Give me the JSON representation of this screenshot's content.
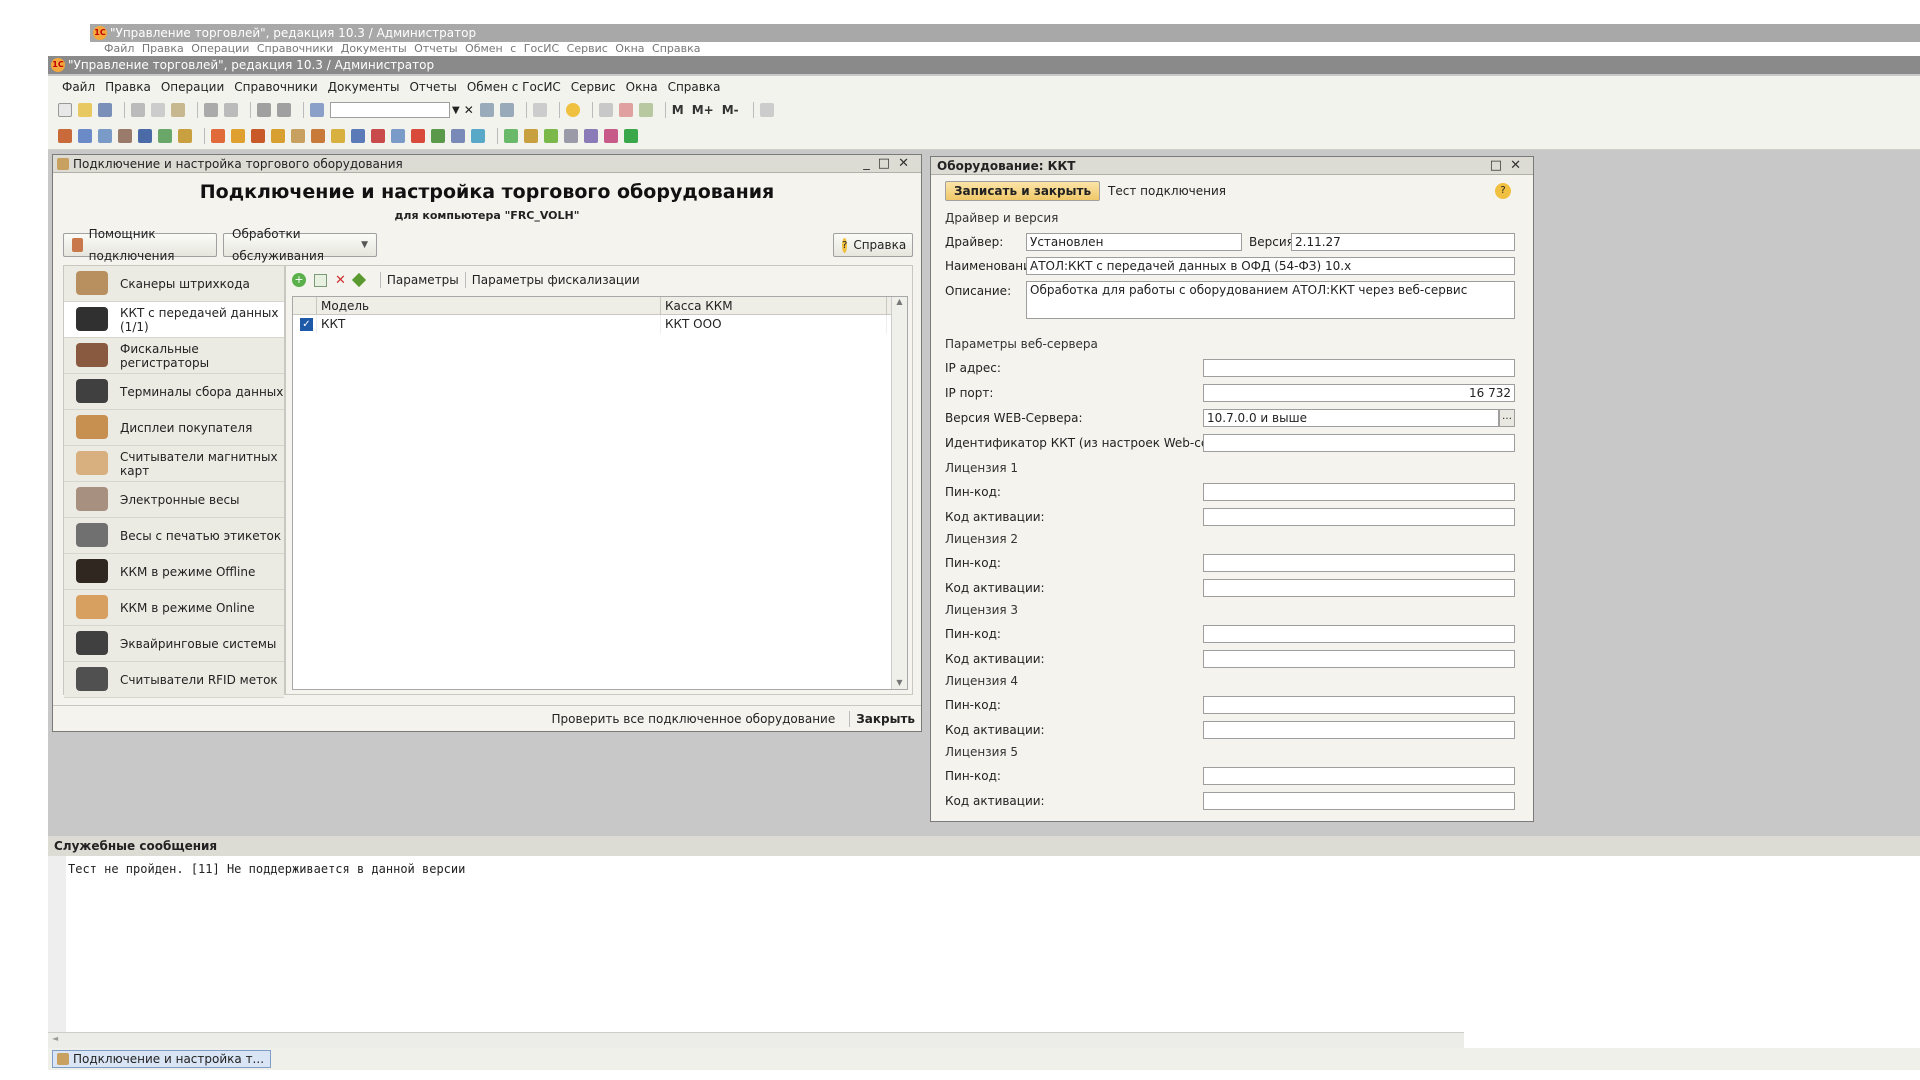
{
  "background_window": {
    "title": "\"Управление торговлей\", редакция 10.3 / Администратор",
    "menu": "Файл Правка Операции Справочники Документы Отчеты Обмен с ГосИС Сервис Окна Справка"
  },
  "main_window": {
    "title": "\"Управление торговлей\", редакция 10.3 / Администратор",
    "logo_text": "1С",
    "menu": [
      "Файл",
      "Правка",
      "Операции",
      "Справочники",
      "Документы",
      "Отчеты",
      "Обмен с ГосИС",
      "Сервис",
      "Окна",
      "Справка"
    ],
    "toolbar_text": [
      "М",
      "М+",
      "М-"
    ]
  },
  "equipment_window": {
    "title": "Подключение и настройка торгового оборудования",
    "heading": "Подключение и настройка торгового оборудования",
    "subheading": "для компьютера \"FRC_VOLH\"",
    "assistant_button": "Помощник подключения",
    "service_button": "Обработки обслуживания",
    "help_button": "Справка",
    "categories": [
      {
        "label": "Сканеры штрихкода",
        "icon": "barcode-scanner-icon"
      },
      {
        "label": "ККТ с передачей данных (1/1)",
        "icon": "cash-register-icon"
      },
      {
        "label": "Фискальные регистраторы",
        "icon": "fiscal-printer-icon"
      },
      {
        "label": "Терминалы сбора данных",
        "icon": "data-terminal-icon"
      },
      {
        "label": "Дисплеи покупателя",
        "icon": "customer-display-icon"
      },
      {
        "label": "Считыватели магнитных карт",
        "icon": "card-reader-icon"
      },
      {
        "label": "Электронные весы",
        "icon": "scales-icon"
      },
      {
        "label": "Весы с печатью этикеток",
        "icon": "label-scales-icon"
      },
      {
        "label": "ККМ в режиме Offline",
        "icon": "kkm-offline-icon"
      },
      {
        "label": "ККМ в режиме Online",
        "icon": "kkm-online-icon"
      },
      {
        "label": "Эквайринговые системы",
        "icon": "acquiring-terminal-icon"
      },
      {
        "label": "Считыватели RFID меток",
        "icon": "rfid-reader-icon"
      }
    ],
    "grid_toolbar": {
      "params": "Параметры",
      "fiscal_params": "Параметры фискализации"
    },
    "grid_columns": [
      "Модель",
      "Касса ККМ"
    ],
    "grid_rows": [
      {
        "model": "ККТ",
        "kassa": "ККТ ООО"
      }
    ],
    "check_all": "Проверить все подключенное оборудование",
    "close": "Закрыть"
  },
  "device_window": {
    "title": "Оборудование: ККТ",
    "save_close": "Записать и закрыть",
    "test": "Тест подключения",
    "section_driver": "Драйвер и версия",
    "driver_label": "Драйвер:",
    "driver_value": "Установлен",
    "version_label": "Версия:",
    "version_value": "2.11.27",
    "name_label": "Наименование:",
    "name_value": "АТОЛ:ККТ с передачей данных в ОФД (54-ФЗ) 10.х",
    "desc_label": "Описание:",
    "desc_value": "Обработка для работы с оборудованием АТОЛ:ККТ через веб-сервис",
    "section_web": "Параметры веб-сервера",
    "ip_label": "IP адрес:",
    "ip_value": "",
    "port_label": "IP порт:",
    "port_value": "16 732",
    "webver_label": "Версия WEB-Сервера:",
    "webver_value": "10.7.0.0 и выше",
    "kkt_id_label": "Идентификатор ККТ (из настроек Web-сервера):",
    "kkt_id_value": "",
    "licenses": [
      {
        "title": "Лицензия 1",
        "pin_label": "Пин-код:",
        "pin": "",
        "code_label": "Код активации:",
        "code": ""
      },
      {
        "title": "Лицензия 2",
        "pin_label": "Пин-код:",
        "pin": "",
        "code_label": "Код активации:",
        "code": ""
      },
      {
        "title": "Лицензия 3",
        "pin_label": "Пин-код:",
        "pin": "",
        "code_label": "Код активации:",
        "code": ""
      },
      {
        "title": "Лицензия 4",
        "pin_label": "Пин-код:",
        "pin": "",
        "code_label": "Код активации:",
        "code": ""
      },
      {
        "title": "Лицензия 5",
        "pin_label": "Пин-код:",
        "pin": "",
        "code_label": "Код активации:",
        "code": ""
      }
    ]
  },
  "messages": {
    "title": "Служебные сообщения",
    "text": "Тест не пройден. [11] Не поддерживается в данной версии"
  },
  "taskbar": {
    "item": "Подключение и настройка т..."
  },
  "colors": {
    "accent_button": "#f5d48a",
    "title_gray": "#8a8a8a",
    "selection": "#ffffff"
  }
}
